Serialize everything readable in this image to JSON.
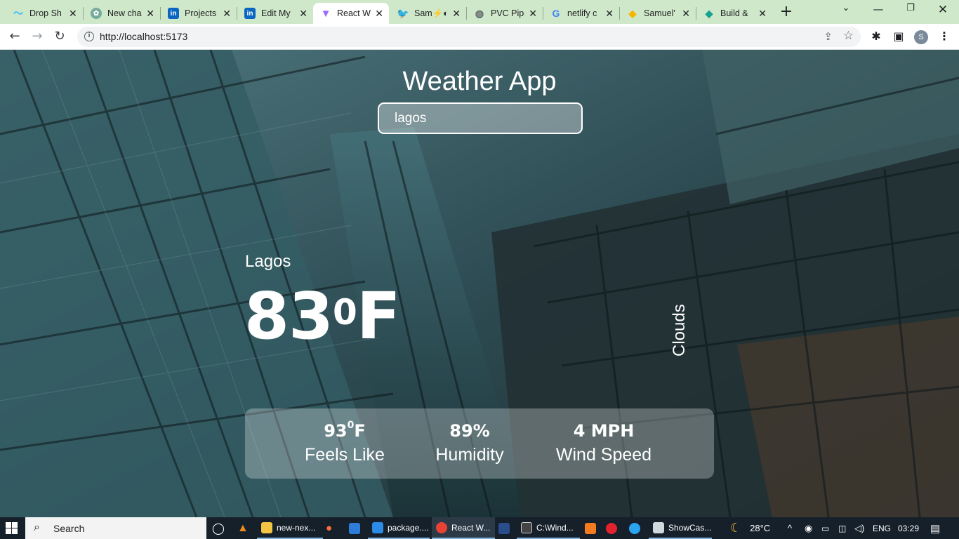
{
  "browser": {
    "tabs": [
      {
        "label": "Drop Sh",
        "icon": "tailwind-icon",
        "color": "#38bdf8"
      },
      {
        "label": "New cha",
        "icon": "chatgpt-icon",
        "color": "#74aa9c"
      },
      {
        "label": "Projects",
        "icon": "linkedin-icon",
        "color": "#0a66c2"
      },
      {
        "label": "Edit My",
        "icon": "linkedin-icon",
        "color": "#0a66c2"
      },
      {
        "label": "React W",
        "icon": "vite-icon",
        "color": "#9b6bff",
        "active": true
      },
      {
        "label": "Sam⚡◐",
        "icon": "twitter-icon",
        "color": "#1d9bf0"
      },
      {
        "label": "PVC Pipe",
        "icon": "globe-icon",
        "color": "#5f6368"
      },
      {
        "label": "netlify c",
        "icon": "google-icon",
        "color": "#4285f4"
      },
      {
        "label": "Samuel'",
        "icon": "sketch-icon",
        "color": "#f7b500"
      },
      {
        "label": "Build &",
        "icon": "netlify-icon",
        "color": "#15a391"
      }
    ],
    "url": "http://localhost:5173",
    "profile_initial": "S"
  },
  "app": {
    "title": "Weather App",
    "search_value": "lagos",
    "city": "Lagos",
    "temp": "83",
    "temp_degree": "0",
    "temp_unit": "F",
    "condition": "Clouds",
    "stats": {
      "feels_like_value": "93",
      "feels_like_degree": "0",
      "feels_like_unit": "F",
      "feels_like_label": "Feels Like",
      "humidity_value": "89%",
      "humidity_label": "Humidity",
      "wind_value": "4 MPH",
      "wind_label": "Wind Speed"
    }
  },
  "taskbar": {
    "search_label": "Search",
    "apps": [
      {
        "label": "new-nex...",
        "icon": "folder-icon"
      },
      {
        "label": "package....",
        "icon": "vscode-icon"
      },
      {
        "label": "React W...",
        "icon": "chrome-icon"
      },
      {
        "label": "C:\\Wind...",
        "icon": "cmd-icon"
      },
      {
        "label": "ShowCas...",
        "icon": "app-icon"
      }
    ],
    "weather": "28°C",
    "language": "ENG",
    "time": "03:29"
  }
}
